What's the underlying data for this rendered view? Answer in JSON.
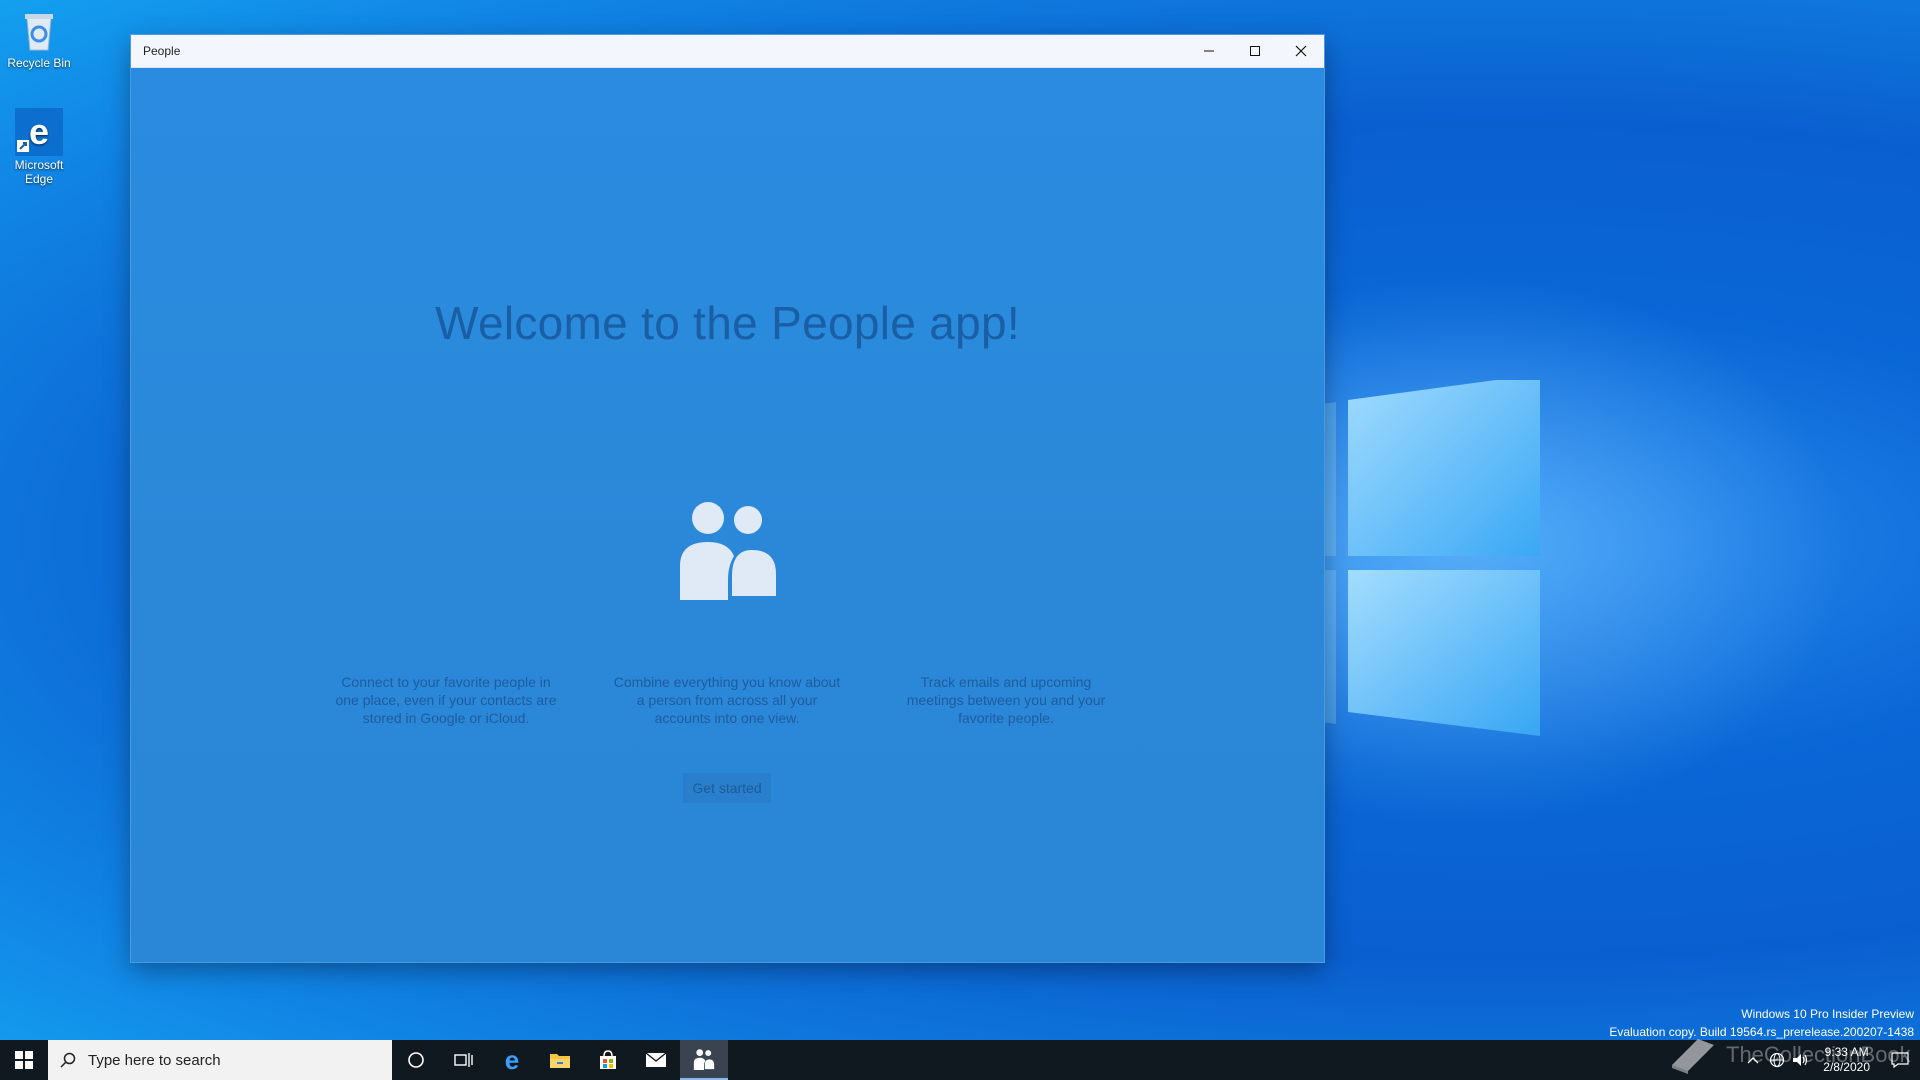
{
  "desktop": {
    "icons": [
      {
        "label": "Recycle Bin"
      },
      {
        "label": "Microsoft Edge"
      }
    ],
    "watermark": {
      "line1": "Windows 10 Pro Insider Preview",
      "line2": "Evaluation copy. Build 19564.rs_prerelease.200207-1438"
    },
    "overlay_text": "TheCollectionBook"
  },
  "window": {
    "title": "People",
    "controls": {
      "minimize": "–",
      "maximize": "☐",
      "close": "✕"
    },
    "welcome_title": "Welcome to the People app!",
    "features": [
      "Connect to your favorite people in one place, even if your contacts are stored in Google or iCloud.",
      "Combine everything you know about a person from across all your accounts into one view.",
      "Track emails and upcoming meetings between you and your favorite people."
    ],
    "get_started_label": "Get started"
  },
  "taskbar": {
    "search_placeholder": "Type here to search",
    "pinned": [
      "cortana-icon",
      "task-view-icon",
      "edge-icon",
      "file-explorer-icon",
      "store-icon",
      "mail-icon",
      "people-icon"
    ],
    "clock": {
      "time": "9:33 AM",
      "date": "2/8/2020"
    }
  },
  "colors": {
    "window_bg": "#2b8ad9",
    "welcome_text": "#1a5fa6",
    "taskbar": "#101820"
  }
}
